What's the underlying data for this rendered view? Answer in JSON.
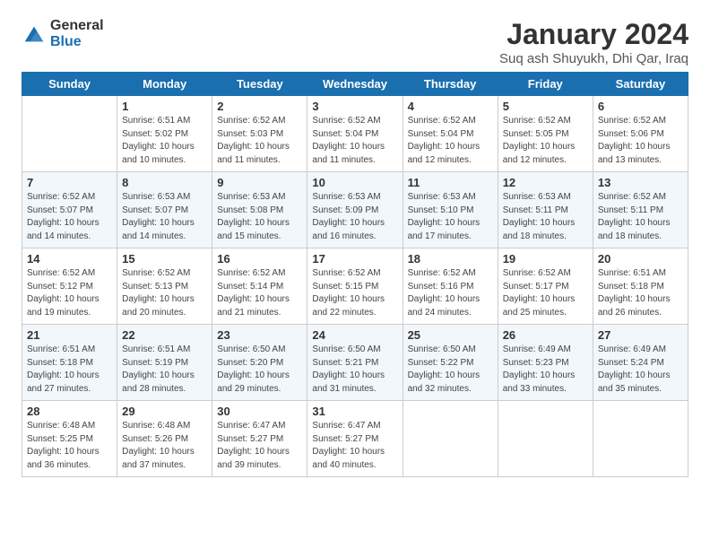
{
  "logo": {
    "general": "General",
    "blue": "Blue"
  },
  "header": {
    "month": "January 2024",
    "location": "Suq ash Shuyukh, Dhi Qar, Iraq"
  },
  "days_of_week": [
    "Sunday",
    "Monday",
    "Tuesday",
    "Wednesday",
    "Thursday",
    "Friday",
    "Saturday"
  ],
  "weeks": [
    [
      {
        "num": "",
        "info": ""
      },
      {
        "num": "1",
        "info": "Sunrise: 6:51 AM\nSunset: 5:02 PM\nDaylight: 10 hours\nand 10 minutes."
      },
      {
        "num": "2",
        "info": "Sunrise: 6:52 AM\nSunset: 5:03 PM\nDaylight: 10 hours\nand 11 minutes."
      },
      {
        "num": "3",
        "info": "Sunrise: 6:52 AM\nSunset: 5:04 PM\nDaylight: 10 hours\nand 11 minutes."
      },
      {
        "num": "4",
        "info": "Sunrise: 6:52 AM\nSunset: 5:04 PM\nDaylight: 10 hours\nand 12 minutes."
      },
      {
        "num": "5",
        "info": "Sunrise: 6:52 AM\nSunset: 5:05 PM\nDaylight: 10 hours\nand 12 minutes."
      },
      {
        "num": "6",
        "info": "Sunrise: 6:52 AM\nSunset: 5:06 PM\nDaylight: 10 hours\nand 13 minutes."
      }
    ],
    [
      {
        "num": "7",
        "info": "Sunrise: 6:52 AM\nSunset: 5:07 PM\nDaylight: 10 hours\nand 14 minutes."
      },
      {
        "num": "8",
        "info": "Sunrise: 6:53 AM\nSunset: 5:07 PM\nDaylight: 10 hours\nand 14 minutes."
      },
      {
        "num": "9",
        "info": "Sunrise: 6:53 AM\nSunset: 5:08 PM\nDaylight: 10 hours\nand 15 minutes."
      },
      {
        "num": "10",
        "info": "Sunrise: 6:53 AM\nSunset: 5:09 PM\nDaylight: 10 hours\nand 16 minutes."
      },
      {
        "num": "11",
        "info": "Sunrise: 6:53 AM\nSunset: 5:10 PM\nDaylight: 10 hours\nand 17 minutes."
      },
      {
        "num": "12",
        "info": "Sunrise: 6:53 AM\nSunset: 5:11 PM\nDaylight: 10 hours\nand 18 minutes."
      },
      {
        "num": "13",
        "info": "Sunrise: 6:52 AM\nSunset: 5:11 PM\nDaylight: 10 hours\nand 18 minutes."
      }
    ],
    [
      {
        "num": "14",
        "info": "Sunrise: 6:52 AM\nSunset: 5:12 PM\nDaylight: 10 hours\nand 19 minutes."
      },
      {
        "num": "15",
        "info": "Sunrise: 6:52 AM\nSunset: 5:13 PM\nDaylight: 10 hours\nand 20 minutes."
      },
      {
        "num": "16",
        "info": "Sunrise: 6:52 AM\nSunset: 5:14 PM\nDaylight: 10 hours\nand 21 minutes."
      },
      {
        "num": "17",
        "info": "Sunrise: 6:52 AM\nSunset: 5:15 PM\nDaylight: 10 hours\nand 22 minutes."
      },
      {
        "num": "18",
        "info": "Sunrise: 6:52 AM\nSunset: 5:16 PM\nDaylight: 10 hours\nand 24 minutes."
      },
      {
        "num": "19",
        "info": "Sunrise: 6:52 AM\nSunset: 5:17 PM\nDaylight: 10 hours\nand 25 minutes."
      },
      {
        "num": "20",
        "info": "Sunrise: 6:51 AM\nSunset: 5:18 PM\nDaylight: 10 hours\nand 26 minutes."
      }
    ],
    [
      {
        "num": "21",
        "info": "Sunrise: 6:51 AM\nSunset: 5:18 PM\nDaylight: 10 hours\nand 27 minutes."
      },
      {
        "num": "22",
        "info": "Sunrise: 6:51 AM\nSunset: 5:19 PM\nDaylight: 10 hours\nand 28 minutes."
      },
      {
        "num": "23",
        "info": "Sunrise: 6:50 AM\nSunset: 5:20 PM\nDaylight: 10 hours\nand 29 minutes."
      },
      {
        "num": "24",
        "info": "Sunrise: 6:50 AM\nSunset: 5:21 PM\nDaylight: 10 hours\nand 31 minutes."
      },
      {
        "num": "25",
        "info": "Sunrise: 6:50 AM\nSunset: 5:22 PM\nDaylight: 10 hours\nand 32 minutes."
      },
      {
        "num": "26",
        "info": "Sunrise: 6:49 AM\nSunset: 5:23 PM\nDaylight: 10 hours\nand 33 minutes."
      },
      {
        "num": "27",
        "info": "Sunrise: 6:49 AM\nSunset: 5:24 PM\nDaylight: 10 hours\nand 35 minutes."
      }
    ],
    [
      {
        "num": "28",
        "info": "Sunrise: 6:48 AM\nSunset: 5:25 PM\nDaylight: 10 hours\nand 36 minutes."
      },
      {
        "num": "29",
        "info": "Sunrise: 6:48 AM\nSunset: 5:26 PM\nDaylight: 10 hours\nand 37 minutes."
      },
      {
        "num": "30",
        "info": "Sunrise: 6:47 AM\nSunset: 5:27 PM\nDaylight: 10 hours\nand 39 minutes."
      },
      {
        "num": "31",
        "info": "Sunrise: 6:47 AM\nSunset: 5:27 PM\nDaylight: 10 hours\nand 40 minutes."
      },
      {
        "num": "",
        "info": ""
      },
      {
        "num": "",
        "info": ""
      },
      {
        "num": "",
        "info": ""
      }
    ]
  ]
}
